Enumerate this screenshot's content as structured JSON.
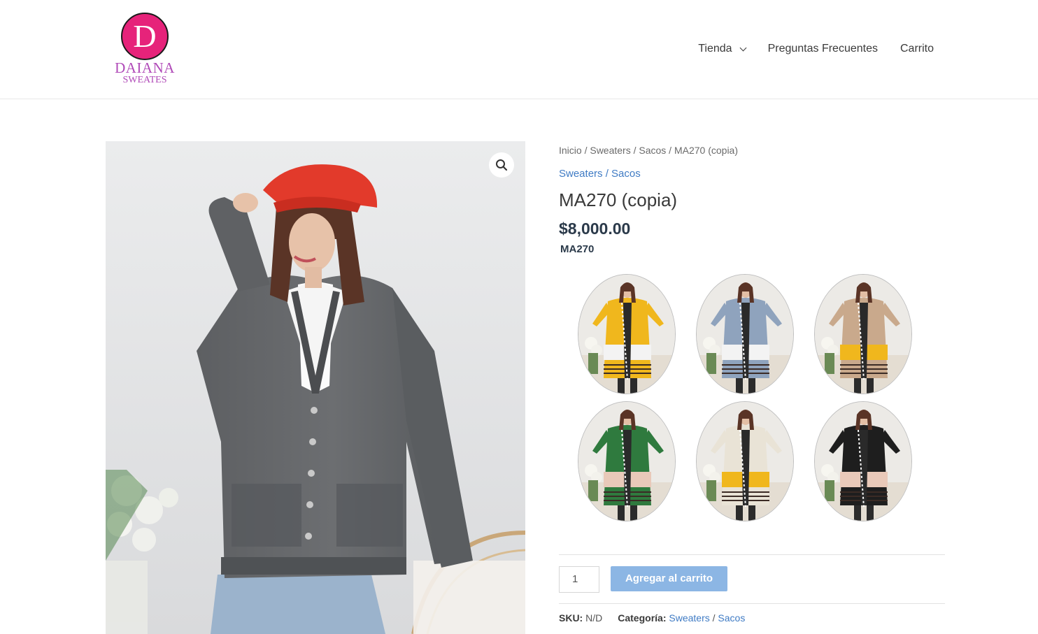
{
  "brand": {
    "logo_letter": "D",
    "name": "DAIANA",
    "sub": "SWEATES",
    "accent": "#e6237a",
    "text_color": "#b04ab8"
  },
  "nav": {
    "items": [
      {
        "label": "Tienda",
        "has_dropdown": true
      },
      {
        "label": "Preguntas Frecuentes"
      },
      {
        "label": "Carrito"
      }
    ]
  },
  "product": {
    "breadcrumb": "Inicio / Sweaters / Sacos / MA270 (copia)",
    "categories": {
      "cat1": "Sweaters",
      "sep": " / ",
      "cat2": "Sacos"
    },
    "title": "MA270 (copia)",
    "price": "$8,000.00",
    "code": "MA270",
    "main_image_icon": "zoom-icon",
    "swatches": [
      {
        "color_name": "yellow",
        "main": "#f0b71d",
        "band": "#f3f3f3"
      },
      {
        "color_name": "blue-gray",
        "main": "#8fa3bd",
        "band": "#f3f3f3"
      },
      {
        "color_name": "beige",
        "main": "#c9a98c",
        "band": "#f0b71d"
      },
      {
        "color_name": "green",
        "main": "#2f7a3e",
        "band": "#e9c9b9"
      },
      {
        "color_name": "cream",
        "main": "#e9e3d6",
        "band": "#f0b71d"
      },
      {
        "color_name": "black",
        "main": "#1e1e1e",
        "band": "#e9c9b9"
      }
    ]
  },
  "cart": {
    "quantity": "1",
    "add_label": "Agregar al carrito"
  },
  "meta": {
    "sku_label": "SKU:",
    "sku_value": "N/D",
    "category_label": "Categoría:",
    "cat1": "Sweaters",
    "sep": " / ",
    "cat2": "Sacos"
  }
}
